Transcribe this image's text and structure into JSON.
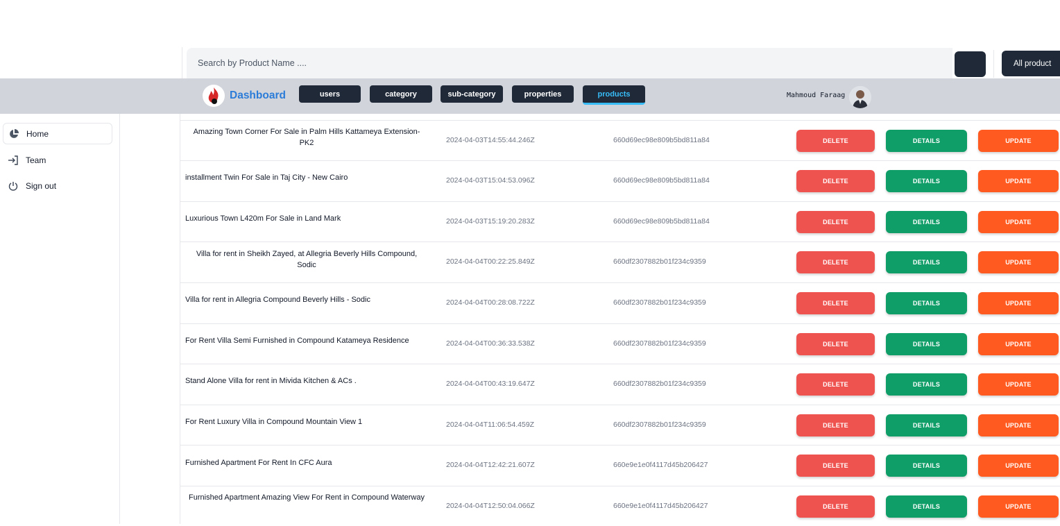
{
  "search": {
    "placeholder": "Search by Product Name ....",
    "all_button": "All product"
  },
  "navbar": {
    "brand": "Dashboard",
    "tabs": [
      {
        "label": "users"
      },
      {
        "label": "category"
      },
      {
        "label": "sub-category"
      },
      {
        "label": "properties"
      },
      {
        "label": "products",
        "active": true
      }
    ],
    "username": "Mahmoud Faraag"
  },
  "sidebar": {
    "items": [
      {
        "label": "Home",
        "icon": "pie-chart-icon",
        "active": true
      },
      {
        "label": "Team",
        "icon": "sign-in-icon"
      },
      {
        "label": "Sign out",
        "icon": "power-icon"
      }
    ]
  },
  "actions": {
    "delete": "DELETE",
    "details": "DETAILS",
    "update": "UPDATE"
  },
  "colors": {
    "delete": "#ef5350",
    "details": "#0f9d68",
    "update": "#ff5a1f",
    "brand": "#2b7bd8",
    "active_tab": "#38bdf8"
  },
  "products": [
    {
      "name": "Amazing Town Corner For Sale in Palm Hills Kattameya Extension-PK2",
      "created": "2024-04-03T14:55:44.246Z",
      "id": "660d69ec98e809b5bd811a84"
    },
    {
      "name": "installment Twin For Sale in Taj City - New Cairo",
      "created": "2024-04-03T15:04:53.096Z",
      "id": "660d69ec98e809b5bd811a84"
    },
    {
      "name": "Luxurious Town L420m For Sale in Land Mark",
      "created": "2024-04-03T15:19:20.283Z",
      "id": "660d69ec98e809b5bd811a84"
    },
    {
      "name": "Villa for rent in Sheikh Zayed, at Allegria Beverly Hills Compound, Sodic",
      "created": "2024-04-04T00:22:25.849Z",
      "id": "660df2307882b01f234c9359"
    },
    {
      "name": "Villa for rent in Allegria Compound Beverly Hills - Sodic",
      "created": "2024-04-04T00:28:08.722Z",
      "id": "660df2307882b01f234c9359"
    },
    {
      "name": "For Rent Villa Semi Furnished in Compound Katameya Residence",
      "created": "2024-04-04T00:36:33.538Z",
      "id": "660df2307882b01f234c9359"
    },
    {
      "name": "Stand Alone Villa for rent in Mivida Kitchen & ACs .",
      "created": "2024-04-04T00:43:19.647Z",
      "id": "660df2307882b01f234c9359"
    },
    {
      "name": "For Rent Luxury Villa in Compound Mountain View 1",
      "created": "2024-04-04T11:06:54.459Z",
      "id": "660df2307882b01f234c9359"
    },
    {
      "name": "Furnished Apartment For Rent In CFC Aura",
      "created": "2024-04-04T12:42:21.607Z",
      "id": "660e9e1e0f4117d45b206427"
    },
    {
      "name": "Furnished Apartment Amazing View For Rent in Compound Waterway",
      "created": "2024-04-04T12:50:04.066Z",
      "id": "660e9e1e0f4117d45b206427"
    }
  ]
}
